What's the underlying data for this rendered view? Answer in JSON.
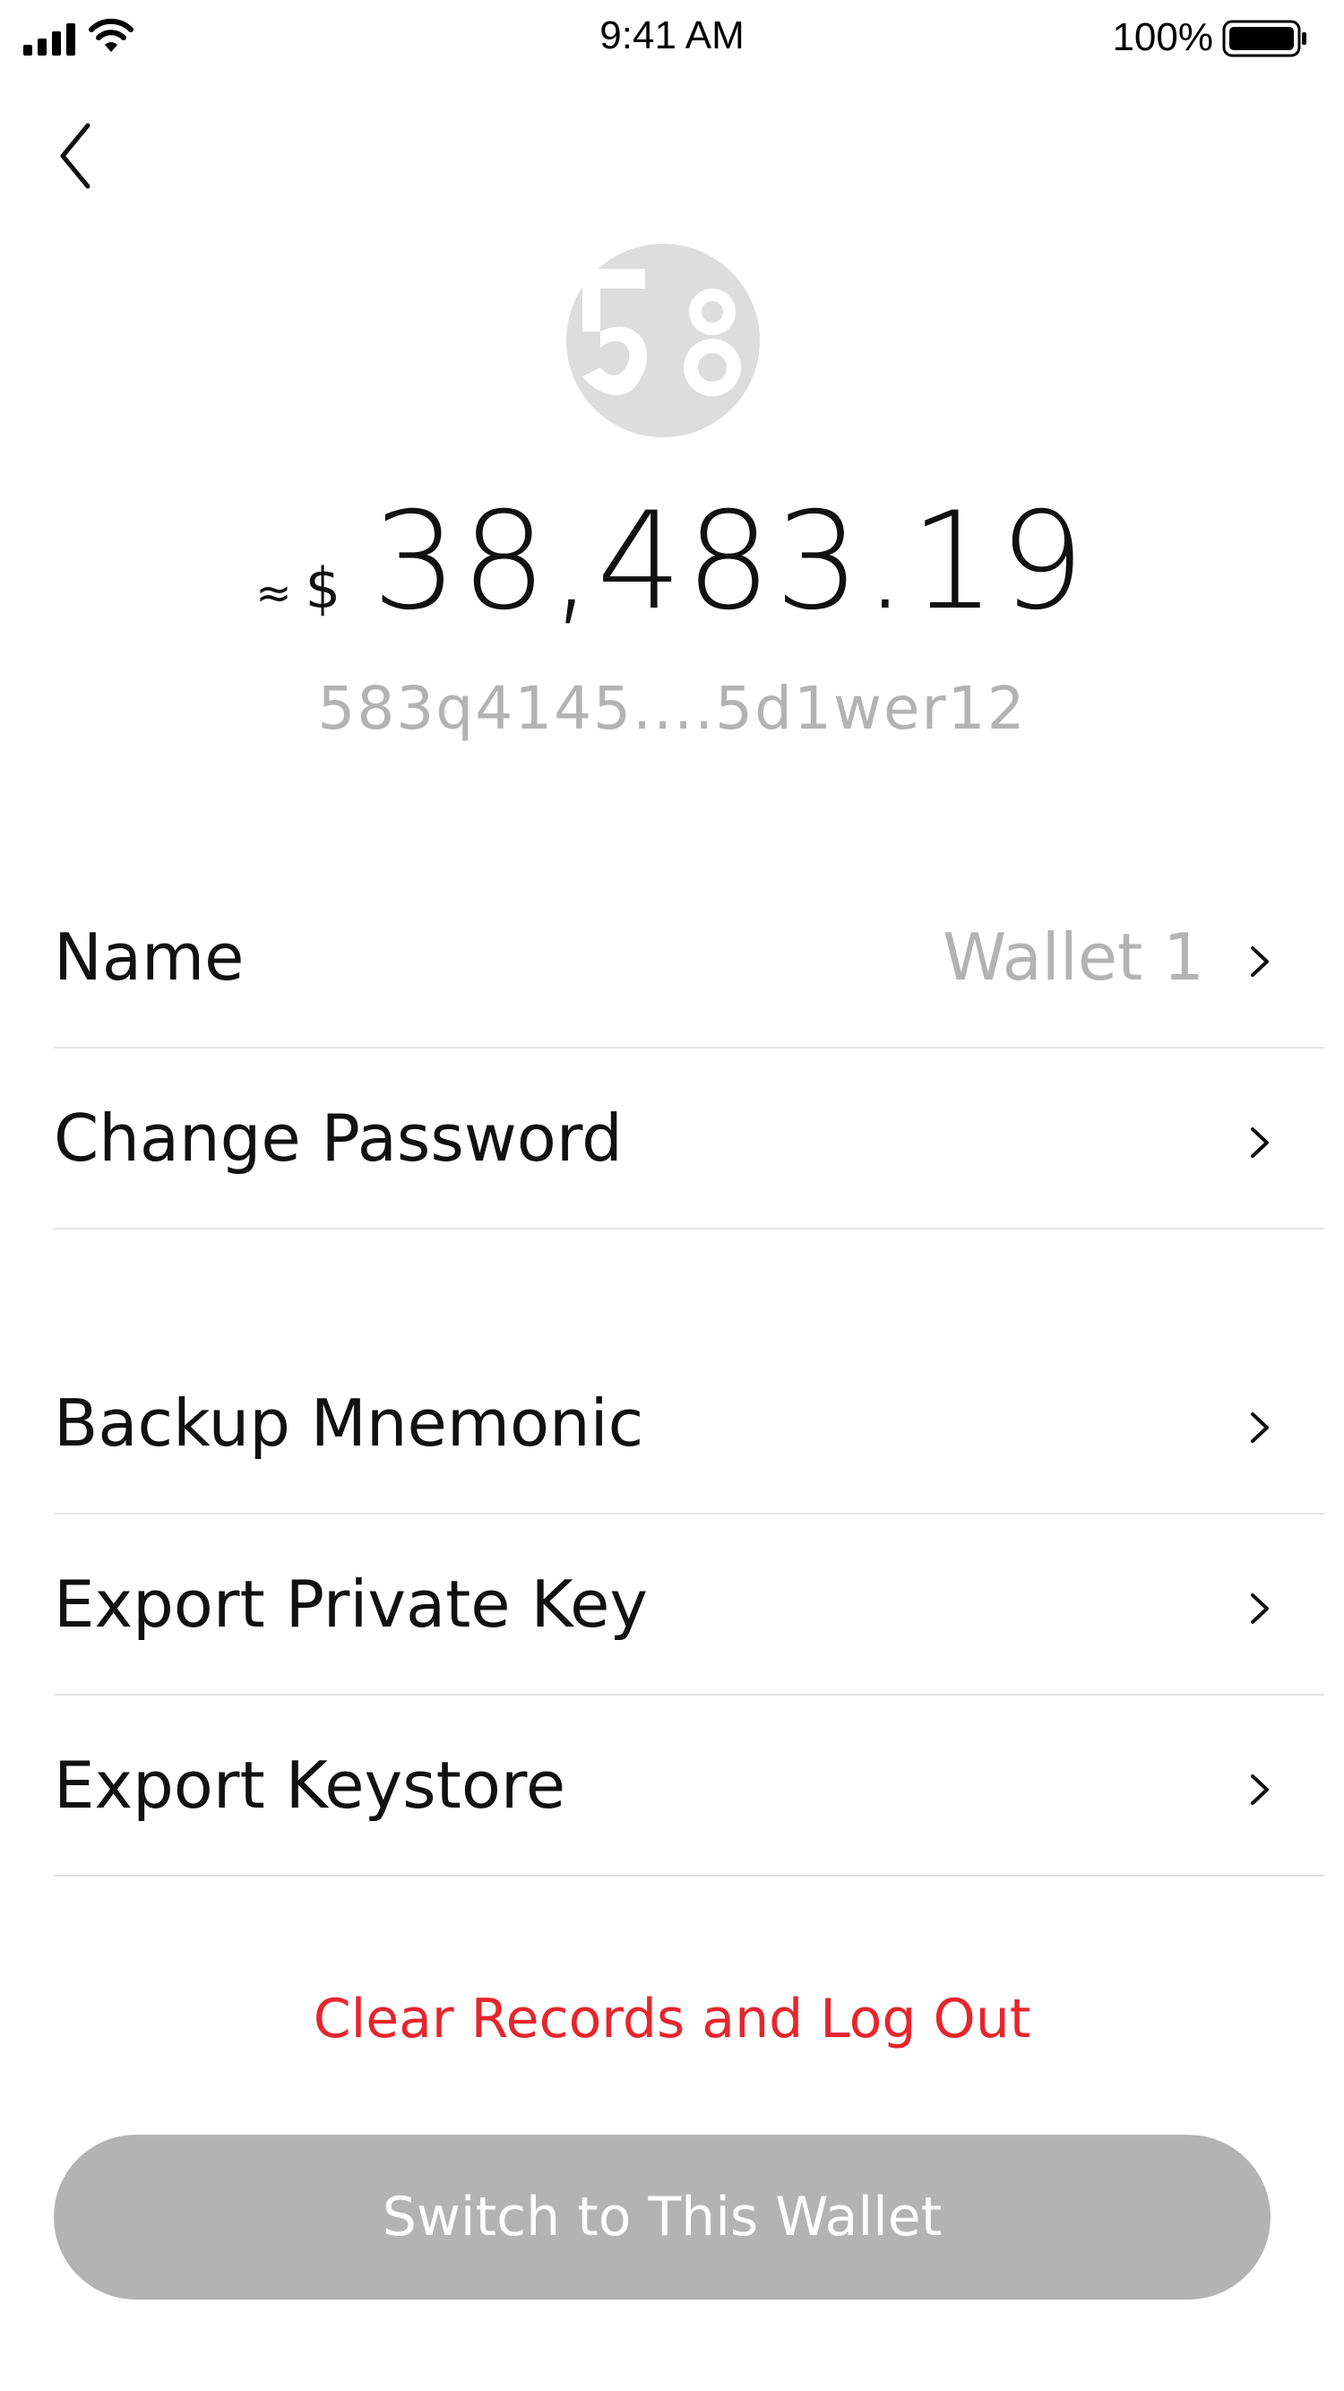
{
  "status_bar": {
    "time": "9:41 AM",
    "battery": "100%",
    "icons": [
      "signal-icon",
      "wifi-icon",
      "battery-icon"
    ]
  },
  "nav": {
    "back_icon": "back-chevron-icon"
  },
  "wallet": {
    "logo_text": "58",
    "approx_symbol": "≈",
    "currency": "$",
    "balance": "38,483.19",
    "address": "583q4145....5d1wer12"
  },
  "settings": {
    "name_label": "Name",
    "name_value": "Wallet 1",
    "change_password_label": "Change Password",
    "backup_mnemonic_label": "Backup Mnemonic",
    "export_private_key_label": "Export Private Key",
    "export_keystore_label": "Export Keystore",
    "chevron_icon": "chevron-right-icon"
  },
  "actions": {
    "logout_label": "Clear Records and Log Out",
    "switch_label": "Switch to This Wallet"
  },
  "colors": {
    "danger": "#e6262c",
    "muted": "#b3b3b3",
    "button_disabled": "#b3b3b3",
    "divider": "#e4e4e4",
    "logo": "#dddddd"
  }
}
